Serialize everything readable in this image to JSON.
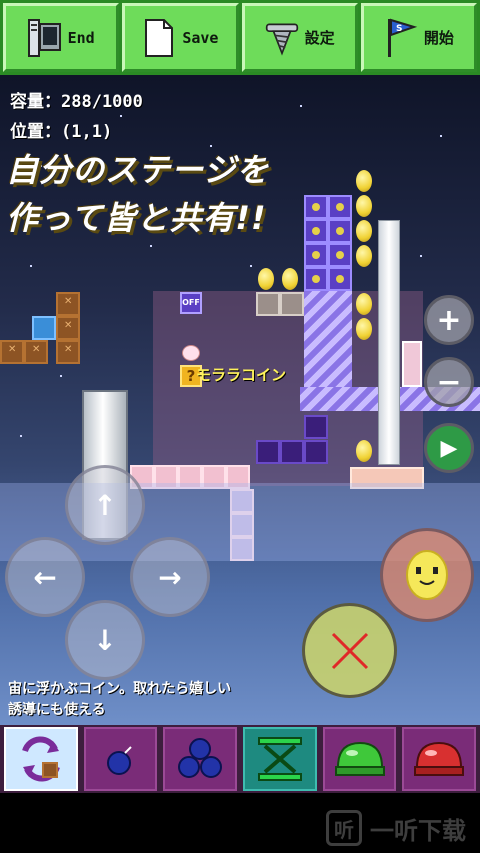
{
  "toolbar": {
    "end_label": "End",
    "save_label": "Save",
    "settings_label": "設定",
    "start_label": "開始"
  },
  "hud": {
    "capacity": "容量：288/1000",
    "position": "位置：(1,1)"
  },
  "promo": {
    "line1": "自分のステージを",
    "line2": "作って皆と共有!!"
  },
  "stage": {
    "off_switch": "OFF",
    "coin_label": "モララコイン",
    "question_mark": "?",
    "play_label": "Play"
  },
  "controls": {
    "up": "↑",
    "down": "↓",
    "left": "←",
    "right": "→",
    "zoom_in": "+",
    "zoom_out": "−",
    "cancel": "✕"
  },
  "hint": {
    "line1": "宙に浮かぶコイン。取れたら嬉しい",
    "line2": "誘導にも使える"
  },
  "palette": {
    "items": [
      "swap-item",
      "bomb-small",
      "bomb-cluster",
      "spring",
      "green-shell",
      "red-shell"
    ],
    "selected": 0
  },
  "watermark": {
    "icon_text": "听",
    "text": "一听下载"
  }
}
